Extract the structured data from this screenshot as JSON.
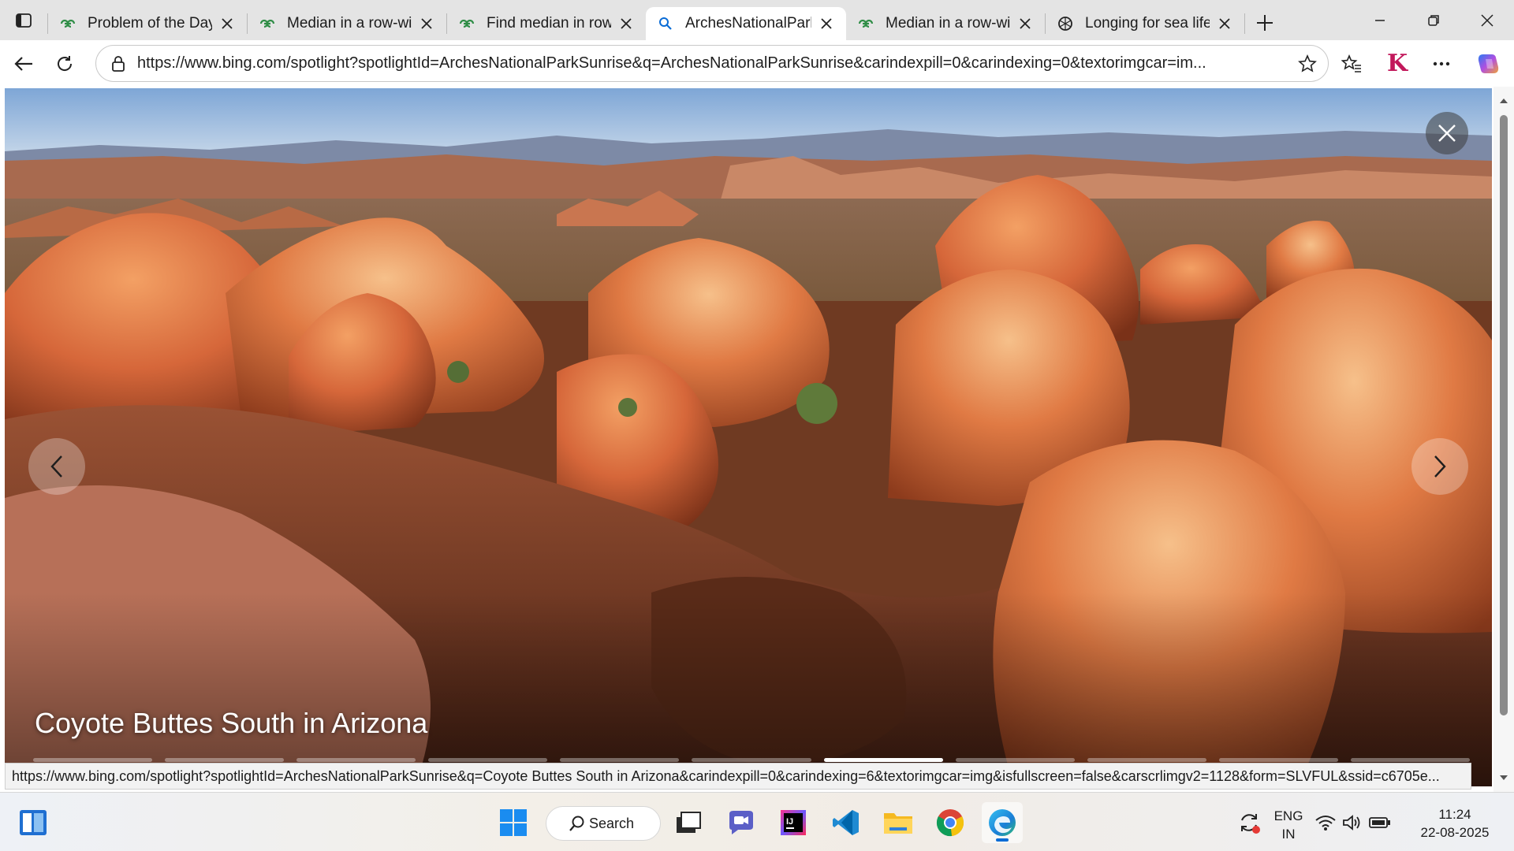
{
  "browser": {
    "tabs": [
      {
        "title": "Problem of the Day |",
        "favicon": "gfg-icon",
        "active": false
      },
      {
        "title": "Median in a row-wis",
        "favicon": "gfg-icon",
        "active": false
      },
      {
        "title": "Find median in row w",
        "favicon": "gfg-icon",
        "active": false
      },
      {
        "title": "ArchesNationalParkS",
        "favicon": "search-icon",
        "active": true
      },
      {
        "title": "Median in a row-wis",
        "favicon": "gfg-icon",
        "active": false
      },
      {
        "title": "Longing for sea life",
        "favicon": "chatgpt-icon",
        "active": false
      }
    ],
    "url": "https://www.bing.com/spotlight?spotlightId=ArchesNationalParkSunrise&q=ArchesNationalParkSunrise&carindexpill=0&carindexing=0&textorimgcar=im...",
    "profile_letter": "K"
  },
  "spotlight": {
    "caption": "Coyote Buttes South in Arizona",
    "slide_count": 11,
    "active_slide": 7
  },
  "status_link": "https://www.bing.com/spotlight?spotlightId=ArchesNationalParkSunrise&q=Coyote Buttes South in Arizona&carindexpill=0&carindexing=6&textorimgcar=img&isfullscreen=false&carscrlimgv2=1128&form=SLVFUL&ssid=c6705e...",
  "taskbar": {
    "search_label": "Search",
    "language": "ENG",
    "region": "IN",
    "time": "11:24",
    "date": "22-08-2025"
  },
  "colors": {
    "edge_accent": "#0a6cd6",
    "gfg_green": "#2f8d46",
    "profile_k": "#c2185b"
  }
}
